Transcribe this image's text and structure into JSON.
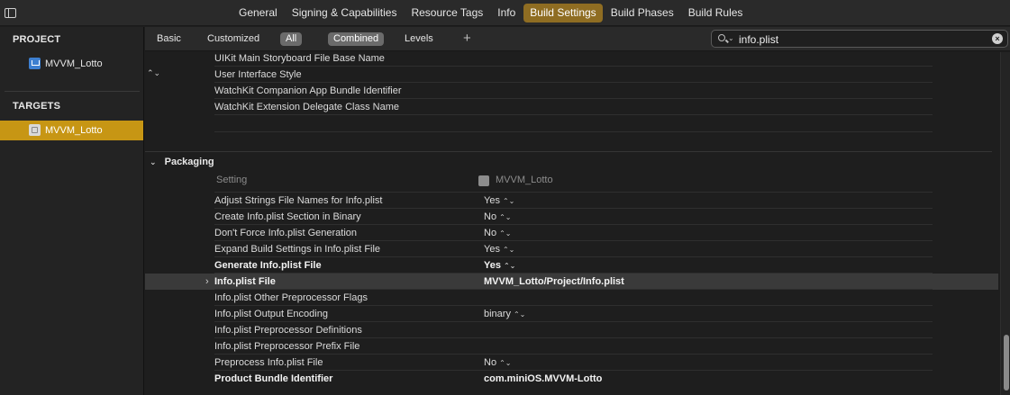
{
  "top_tabs": [
    {
      "label": "General",
      "active": false
    },
    {
      "label": "Signing & Capabilities",
      "active": false
    },
    {
      "label": "Resource Tags",
      "active": false
    },
    {
      "label": "Info",
      "active": false
    },
    {
      "label": "Build Settings",
      "active": true
    },
    {
      "label": "Build Phases",
      "active": false
    },
    {
      "label": "Build Rules",
      "active": false
    }
  ],
  "sidebar": {
    "project_header": "PROJECT",
    "project_item": "MVVM_Lotto",
    "targets_header": "TARGETS",
    "target_item": "MVVM_Lotto"
  },
  "filter_bar": {
    "basic": "Basic",
    "customized": "Customized",
    "all": "All",
    "combined": "Combined",
    "levels": "Levels",
    "add": "+",
    "search_value": "info.plist",
    "search_caret": "⌄",
    "clear": "×"
  },
  "prev_rows": [
    {
      "name": "UIKit Main Storyboard File Base Name",
      "value": ""
    },
    {
      "name": "User Interface Style",
      "value": ""
    },
    {
      "name": "WatchKit Companion App Bundle Identifier",
      "value": ""
    },
    {
      "name": "WatchKit Extension Delegate Class Name",
      "value": ""
    }
  ],
  "packaging": {
    "title": "Packaging",
    "chevron": "⌄",
    "setting_col": "Setting",
    "target_col": "MVVM_Lotto",
    "rows": [
      {
        "name": "Adjust Strings File Names for Info.plist",
        "value": "Yes",
        "stepper": "⌃⌄",
        "bold": false
      },
      {
        "name": "Create Info.plist Section in Binary",
        "value": "No",
        "stepper": "⌃⌄",
        "bold": false
      },
      {
        "name": "Don't Force Info.plist Generation",
        "value": "No",
        "stepper": "⌃⌄",
        "bold": false
      },
      {
        "name": "Expand Build Settings in Info.plist File",
        "value": "Yes",
        "stepper": "⌃⌄",
        "bold": false
      },
      {
        "name": "Generate Info.plist File",
        "value": "Yes",
        "stepper": "⌃⌄",
        "bold": true
      },
      {
        "name": "Info.plist File",
        "value": "MVVM_Lotto/Project/Info.plist",
        "stepper": "",
        "bold": true,
        "selected": true
      },
      {
        "name": "Info.plist Other Preprocessor Flags",
        "value": "",
        "stepper": "",
        "bold": false
      },
      {
        "name": "Info.plist Output Encoding",
        "value": "binary",
        "stepper": "⌃⌄",
        "bold": false
      },
      {
        "name": "Info.plist Preprocessor Definitions",
        "value": "",
        "stepper": "",
        "bold": false
      },
      {
        "name": "Info.plist Preprocessor Prefix File",
        "value": "",
        "stepper": "",
        "bold": false
      },
      {
        "name": "Preprocess Info.plist File",
        "value": "No",
        "stepper": "⌃⌄",
        "bold": false
      },
      {
        "name": "Product Bundle Identifier",
        "value": "com.miniOS.MVVM-Lotto",
        "stepper": "",
        "bold": true
      }
    ]
  },
  "glyphs": {
    "updown": "⌃⌄",
    "disclosure": "›"
  }
}
